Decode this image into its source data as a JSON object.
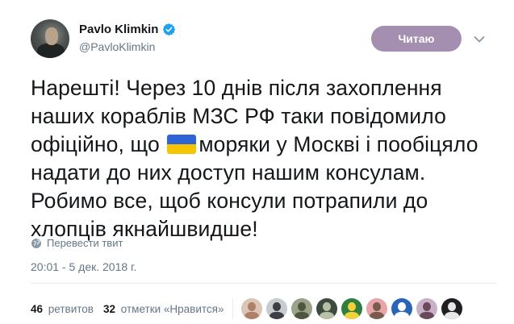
{
  "author": {
    "display_name": "Pavlo Klimkin",
    "handle": "@PavloKlimkin",
    "verified": true,
    "verified_color": "#1da1f2"
  },
  "follow_button": {
    "label": "Читаю",
    "color": "#a58fb0"
  },
  "menu": {
    "icon": "chevron-down-icon"
  },
  "tweet": {
    "text_before_flag": "Нарешті! Через 10 днів після захоплення наших кораблів МЗС РФ таки повідомило офіційно, що ",
    "flag_emoji": "ukraine-flag-icon",
    "text_after_flag": "моряки у Москві і пообіцяло надати до них доступ нашим консулам. Робимо все, щоб консули потрапили до хлопців якнайшвидше!"
  },
  "translate": {
    "label": "Перевести твит",
    "icon": "globe-icon"
  },
  "timestamp": "20:01 - 5 дек. 2018 г.",
  "stats": {
    "retweets_count": "46",
    "retweets_label": "ретвитов",
    "likes_count": "32",
    "likes_label": "отметки «Нравится»"
  },
  "likers": [
    {
      "icon": "avatar-1",
      "bg": "#d9c6b6",
      "fg": "#b07f68"
    },
    {
      "icon": "avatar-2",
      "bg": "#c9cccf",
      "fg": "#3b3f44"
    },
    {
      "icon": "avatar-3",
      "bg": "#9aa28a",
      "fg": "#50553f"
    },
    {
      "icon": "avatar-4",
      "bg": "#3d4a3f",
      "fg": "#b9c0a8"
    },
    {
      "icon": "avatar-5",
      "bg": "#2f7d3f",
      "fg": "#f2d23a"
    },
    {
      "icon": "avatar-6",
      "bg": "#e9a6a8",
      "fg": "#7a5a4a"
    },
    {
      "icon": "avatar-7",
      "bg": "#2a64b8",
      "fg": "#ffffff"
    },
    {
      "icon": "avatar-8",
      "bg": "#c8b0c8",
      "fg": "#6a4a5a"
    },
    {
      "icon": "avatar-9",
      "bg": "#1d1f22",
      "fg": "#e7e7e7"
    }
  ]
}
